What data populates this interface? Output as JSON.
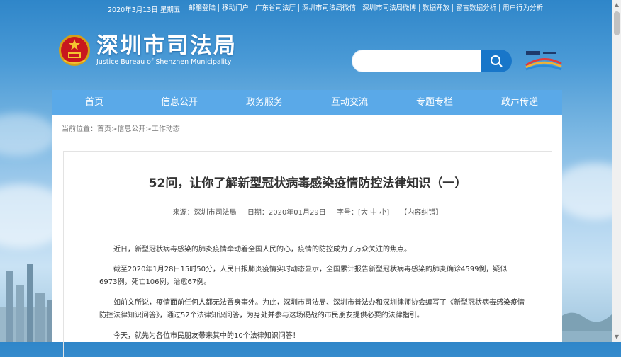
{
  "topbar": {
    "date": "2020年3月13日 星期五",
    "links": [
      "邮箱登陆",
      "移动门户",
      "广东省司法厅",
      "深圳市司法局微信",
      "深圳市司法局微博",
      "数据开放",
      "留言数据分析",
      "用户行为分析"
    ]
  },
  "logo": {
    "name_cn": "深圳市司法局",
    "name_en": "Justice Bureau of Shenzhen Municipality"
  },
  "search": {
    "placeholder": "",
    "icon": "search-icon"
  },
  "nav": [
    "首页",
    "信息公开",
    "政务服务",
    "互动交流",
    "专题专栏",
    "政声传递"
  ],
  "breadcrumb": "当前位置：首页>信息公开>工作动态",
  "article": {
    "title": "52问，让你了解新型冠状病毒感染疫情防控法律知识（一）",
    "meta": {
      "source": "来源：深圳市司法局",
      "date": "日期：2020年01月29日",
      "font": "字号：[大 中 小]",
      "correction": "【内容纠错】"
    },
    "paragraphs": [
      "近日，新型冠状病毒感染的肺炎疫情牵动着全国人民的心，疫情的防控成为了万众关注的焦点。",
      "截至2020年1月28日15时50分，人民日报肺炎疫情实时动态显示，全国累计报告新型冠状病毒感染的肺炎确诊4599例，疑似6973例，死亡106例，治愈67例。",
      "如前文所说，疫情面前任何人都无法置身事外。为此，深圳市司法局、深圳市普法办和深圳律师协会编写了《新型冠状病毒感染疫情防控法律知识问答》，通过52个法律知识问答，为身处并参与这场硬战的市民朋友提供必要的法律指引。",
      "今天，就先为各位市民朋友带来其中的10个法律知识问答！"
    ]
  },
  "colors": {
    "nav": "#5aa9e8",
    "search_button": "#1876c9",
    "page_bg": "#4a9ad6"
  }
}
